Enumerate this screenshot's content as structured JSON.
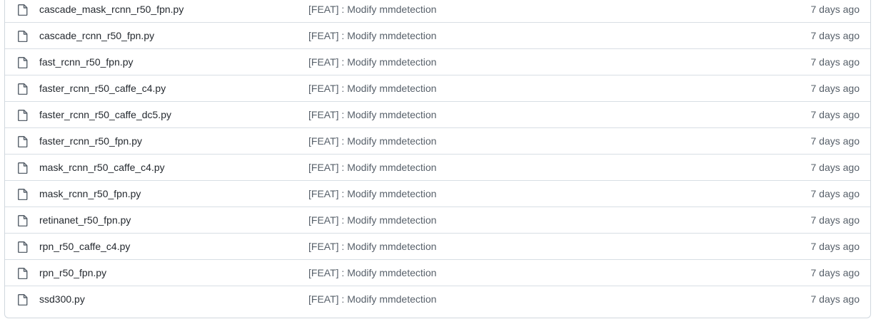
{
  "files": [
    {
      "name": "cascade_mask_rcnn_r50_fpn.py",
      "commit": "[FEAT] : Modify mmdetection",
      "age": "7 days ago",
      "icon": "file-icon"
    },
    {
      "name": "cascade_rcnn_r50_fpn.py",
      "commit": "[FEAT] : Modify mmdetection",
      "age": "7 days ago",
      "icon": "file-icon"
    },
    {
      "name": "fast_rcnn_r50_fpn.py",
      "commit": "[FEAT] : Modify mmdetection",
      "age": "7 days ago",
      "icon": "file-icon"
    },
    {
      "name": "faster_rcnn_r50_caffe_c4.py",
      "commit": "[FEAT] : Modify mmdetection",
      "age": "7 days ago",
      "icon": "file-icon"
    },
    {
      "name": "faster_rcnn_r50_caffe_dc5.py",
      "commit": "[FEAT] : Modify mmdetection",
      "age": "7 days ago",
      "icon": "file-icon"
    },
    {
      "name": "faster_rcnn_r50_fpn.py",
      "commit": "[FEAT] : Modify mmdetection",
      "age": "7 days ago",
      "icon": "file-icon"
    },
    {
      "name": "mask_rcnn_r50_caffe_c4.py",
      "commit": "[FEAT] : Modify mmdetection",
      "age": "7 days ago",
      "icon": "file-icon"
    },
    {
      "name": "mask_rcnn_r50_fpn.py",
      "commit": "[FEAT] : Modify mmdetection",
      "age": "7 days ago",
      "icon": "file-icon"
    },
    {
      "name": "retinanet_r50_fpn.py",
      "commit": "[FEAT] : Modify mmdetection",
      "age": "7 days ago",
      "icon": "file-icon"
    },
    {
      "name": "rpn_r50_caffe_c4.py",
      "commit": "[FEAT] : Modify mmdetection",
      "age": "7 days ago",
      "icon": "file-icon"
    },
    {
      "name": "rpn_r50_fpn.py",
      "commit": "[FEAT] : Modify mmdetection",
      "age": "7 days ago",
      "icon": "file-icon"
    },
    {
      "name": "ssd300.py",
      "commit": "[FEAT] : Modify mmdetection",
      "age": "7 days ago",
      "icon": "file-icon"
    }
  ],
  "colors": {
    "border": "#d0d7de",
    "row_divider": "#d8dee4",
    "text": "#24292f",
    "muted": "#57606a",
    "icon": "#57606a"
  }
}
